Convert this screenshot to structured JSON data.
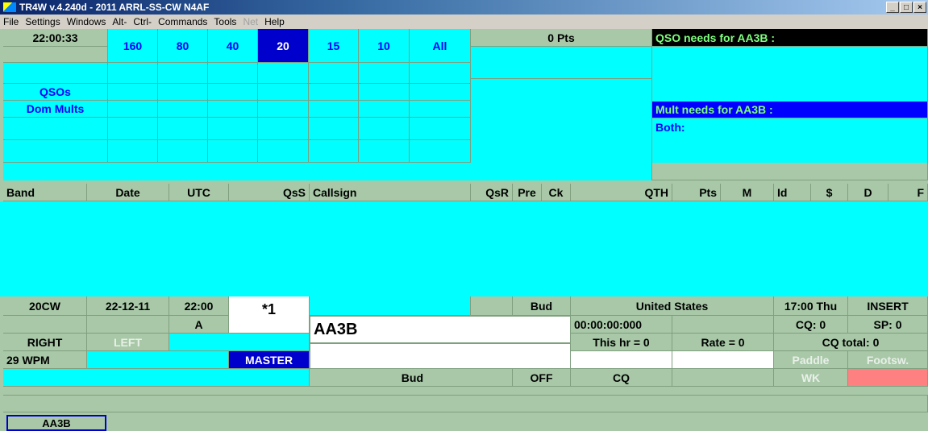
{
  "window": {
    "title": "TR4W v.4.240d - 2011 ARRL-SS-CW N4AF"
  },
  "menu": [
    "File",
    "Settings",
    "Windows",
    "Alt-",
    "Ctrl-",
    "Commands",
    "Tools",
    "Net",
    "Help"
  ],
  "grid": {
    "time": "22:00:33",
    "bands": [
      "160",
      "80",
      "40",
      "20",
      "15",
      "10",
      "All"
    ],
    "selected_band": "20",
    "row_labels": [
      "QSOs",
      "Dom Mults"
    ]
  },
  "points": "0 Pts",
  "qso_needs": "QSO needs for AA3B :",
  "mult_needs": "Mult needs for AA3B :",
  "both_label": "Both:",
  "log_headers": [
    "Band",
    "Date",
    "UTC",
    "QsS",
    "Callsign",
    "QsR",
    "Pre",
    "Ck",
    "QTH",
    "Pts",
    "M",
    "Id",
    "$",
    "D",
    "F"
  ],
  "status": {
    "band_mode": "20CW",
    "date": "22-12-11",
    "utc": "22:00",
    "serial": "*1",
    "name_field": "Bud",
    "country": "United States",
    "local_time": "17:00 Thu",
    "insert_mode": "INSERT",
    "radio_a": "A",
    "callsign_entry": "AA3B",
    "elapsed": "00:00:00:000",
    "cq_count": "CQ: 0",
    "sp_count": "SP: 0",
    "right_label": "RIGHT",
    "left_label": "LEFT",
    "this_hr": "This hr = 0",
    "rate": "Rate = 0",
    "cq_total": "CQ total: 0",
    "wpm": "29 WPM",
    "master": "MASTER",
    "paddle": "Paddle",
    "footsw": "Footsw.",
    "bottom_name": "Bud",
    "off": "OFF",
    "cq": "CQ",
    "wk": "WK"
  },
  "bandmap_call": "AA3B"
}
